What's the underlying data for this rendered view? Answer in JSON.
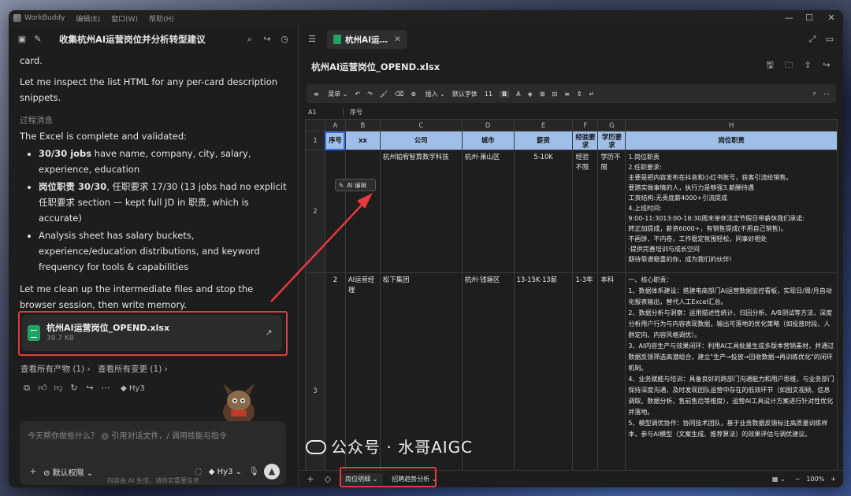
{
  "window": {
    "app_name": "WorkBuddy",
    "menus": [
      "编辑(E)",
      "窗口(W)",
      "帮助(H)"
    ]
  },
  "left": {
    "conversation_title": "收集杭州AI运营岗位并分析转型建议",
    "messages": {
      "m0": "card.",
      "m1": "Let me inspect the list HTML for any per-card description snippets.",
      "process_label": "过程消息",
      "m2": "The Excel is complete and validated:",
      "b1_bold": "30/30 jobs",
      "b1_rest": " have name, company, city, salary, experience, education",
      "b2_bold": "岗位职责 30/30",
      "b2_rest": ", 任职要求 17/30 (13 jobs had no explicit 任职要求 section — kept full JD in 职责, which is accurate)",
      "b3": "Analysis sheet has salary buckets, experience/education distributions, and keyword frequency for tools & capabilities",
      "m3": "Let me clean up the intermediate files and stop the browser session, then write memory."
    },
    "file_card": {
      "name": "杭州AI运营岗位_OPEND.xlsx",
      "size": "39.7 KB"
    },
    "links": {
      "all_outputs": "查看所有产物 (1)",
      "all_changes": "查看所有变更 (1)"
    },
    "model_tag": "Hy3",
    "composer": {
      "placeholder": "今天帮你做些什么？ @ 引用对话文件，/ 调用技能与指令",
      "permission": "默认权限",
      "model": "Hy3"
    },
    "footer_note": "内容由 AI 生成，请核实重要信息"
  },
  "right": {
    "tab_label": "杭州AI运…",
    "doc_title": "杭州AI运营岗位_OPEND.xlsx",
    "toolbar": {
      "menu": "菜单",
      "insert": "插入",
      "font": "默认字体",
      "size": "11",
      "bold": "B",
      "color_a": "A"
    },
    "cell_ref": "A1",
    "formula": "序号",
    "ai_edit": "AI 编辑",
    "columns": [
      "A",
      "B",
      "C",
      "D",
      "E",
      "F",
      "G",
      "H"
    ],
    "header_row": [
      "序号",
      "xx",
      "公司",
      "城市",
      "薪资",
      "经验要求",
      "学历要求",
      "岗位职责"
    ],
    "rows": [
      {
        "num": "2",
        "cells": [
          "",
          "",
          "杭州铂宥智算数字科技",
          "杭州·萧山区",
          "5-10K",
          "经验不限",
          "学历不限",
          "1.岗位职责\n2.任职要求:\n主要是把内容发布在抖音和小红书账号，获客引流给销售。\n要踏实做事情的人，执行力是够强3.薪酬待遇\n工资结构:无责底薪4000+引流提成\n4.上班时间:\n9:00-11:3013:00-18:30周末单休法定节假日带薪休我们承诺:\n转正加提成，薪资6000+，有销售提成(不用自己销售)。\n不画饼、不内卷，工作稳定氛围轻松，同事好相处\n·提供完善培训与成长空间\n期待靠谱稳重的你，成为我们的伙伴!"
        ]
      },
      {
        "num": "3",
        "cells": [
          "2",
          "AI运营经理",
          "松下集团",
          "杭州·钱塘区",
          "13-15K·13薪",
          "1-3年",
          "本科",
          "一、核心职责：\n1、数据体系建设：搭建电商部门AI运营数据监控看板，实现日/周/月自动化报表输出，替代人工Excel汇总。\n2、数据分析与洞察：运用描述性统计、归因分析、A/B测试等方法，深度分析用户行为与内容表现数据，输出可落地的优化策略（如投放时段、人群定向、内容风格调优）。\n3、AI内容生产与效果闭环：利用AI工具批量生成多版本营销素材，并通过数据反馈筛选高潜组合，建立\"生产→投放→回收数据→再训练优化\"的闭环机制。\n4、业务赋能与培训：具备良好的跨部门沟通能力和用户思维，与业务部门保持深度沟通，及时发现团队运营中存在的低效环节（如图文视频、信息调取、数据分析、售前售后等维度），运营AI工具设计方案进行针对性优化并落地。\n5、模型调优协作：协同技术团队，基于业务数据反馈标注高质量训练样本，参与AI模型（文案生成、推荐算法）的效果评估与调优建议。"
        ]
      }
    ],
    "sheets": [
      "岗位明细",
      "招聘趋势分析"
    ],
    "zoom": "100%"
  },
  "watermark": "公众号 · 水哥AIGC",
  "accent_colors": {
    "highlight": "#e6393b",
    "header_fill": "#9fbfe8",
    "excel_green": "#21a366"
  }
}
